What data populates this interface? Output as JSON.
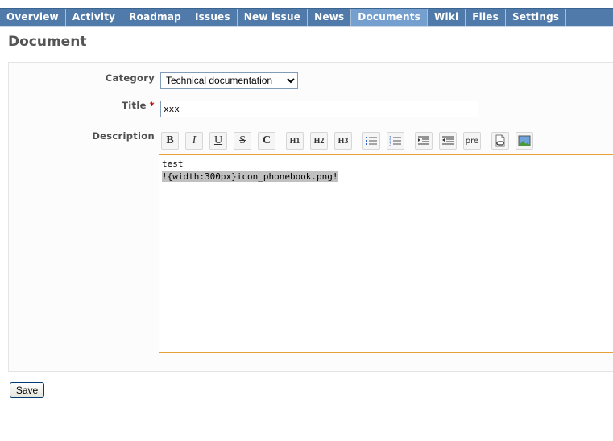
{
  "tabs": [
    {
      "label": "Overview",
      "selected": false
    },
    {
      "label": "Activity",
      "selected": false
    },
    {
      "label": "Roadmap",
      "selected": false
    },
    {
      "label": "Issues",
      "selected": false
    },
    {
      "label": "New issue",
      "selected": false
    },
    {
      "label": "News",
      "selected": false
    },
    {
      "label": "Documents",
      "selected": true
    },
    {
      "label": "Wiki",
      "selected": false
    },
    {
      "label": "Files",
      "selected": false
    },
    {
      "label": "Settings",
      "selected": false
    }
  ],
  "page_title": "Document",
  "form": {
    "category_label": "Category",
    "category_value": "Technical documentation",
    "title_label": "Title",
    "required_mark": "*",
    "title_value": "xxx",
    "description_label": "Description",
    "description_line1": "test",
    "description_line2": "!{width:300px}icon_phonebook.png!"
  },
  "toolbar": {
    "bold": "B",
    "italic": "I",
    "underline": "U",
    "strike": "S",
    "code": "C",
    "h1": "H1",
    "h2": "H2",
    "h3": "H3",
    "pre": "pre",
    "icons": [
      "bold-icon",
      "italic-icon",
      "underline-icon",
      "strikethrough-icon",
      "inline-code-icon",
      "heading1-icon",
      "heading2-icon",
      "heading3-icon",
      "unordered-list-icon",
      "ordered-list-icon",
      "quote-icon",
      "unquote-icon",
      "preformatted-icon",
      "wiki-link-icon",
      "image-icon"
    ]
  },
  "buttons": {
    "save": "Save"
  },
  "colors": {
    "tab_bar": "#507aaa",
    "tab_selected": "#759fcf",
    "editor_border": "#e6a03a",
    "required": "#bb0000"
  }
}
